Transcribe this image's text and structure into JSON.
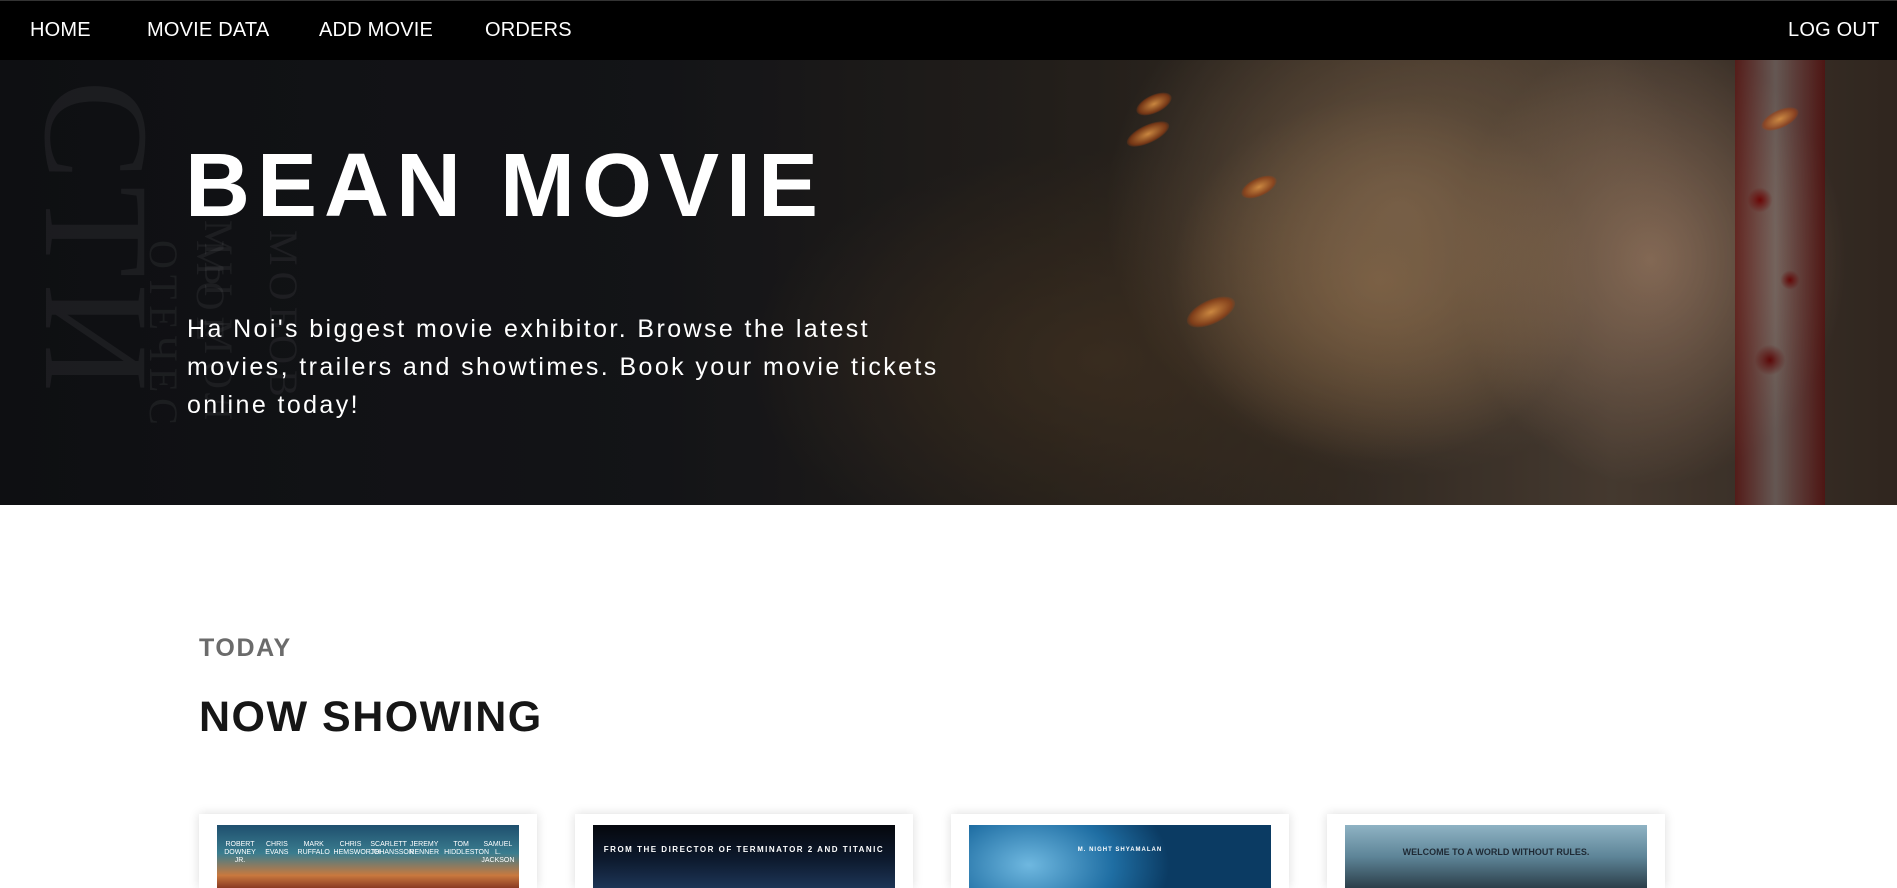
{
  "nav": {
    "home": "HOME",
    "movie_data": "MOVIE DATA",
    "add_movie": "ADD MOVIE",
    "orders": "ORDERS",
    "logout": "LOG OUT"
  },
  "hero": {
    "title": "BEAN MOVIE",
    "subtitle": "Ha Noi's biggest movie exhibitor. Browse the latest movies, trailers and showtimes. Book your movie tickets online today!"
  },
  "section": {
    "eyebrow": "TODAY",
    "title": "NOW SHOWING"
  },
  "posters": [
    {
      "cast": [
        "ROBERT DOWNEY JR.",
        "CHRIS EVANS",
        "MARK RUFFALO",
        "CHRIS HEMSWORTH",
        "SCARLETT JOHANSSON",
        "JEREMY RENNER",
        "TOM HIDDLESTON",
        "SAMUEL L. JACKSON"
      ]
    },
    {
      "tagline": "FROM THE DIRECTOR OF TERMINATOR 2 AND TITANIC"
    },
    {
      "tagline": "M. NIGHT SHYAMALAN"
    },
    {
      "tagline": "WELCOME TO A WORLD WITHOUT RULES."
    }
  ],
  "colors": {
    "nav_bg": "#000000",
    "hero_text": "#ffffff",
    "eyebrow": "#6b6b6b",
    "section_title": "#161616"
  }
}
